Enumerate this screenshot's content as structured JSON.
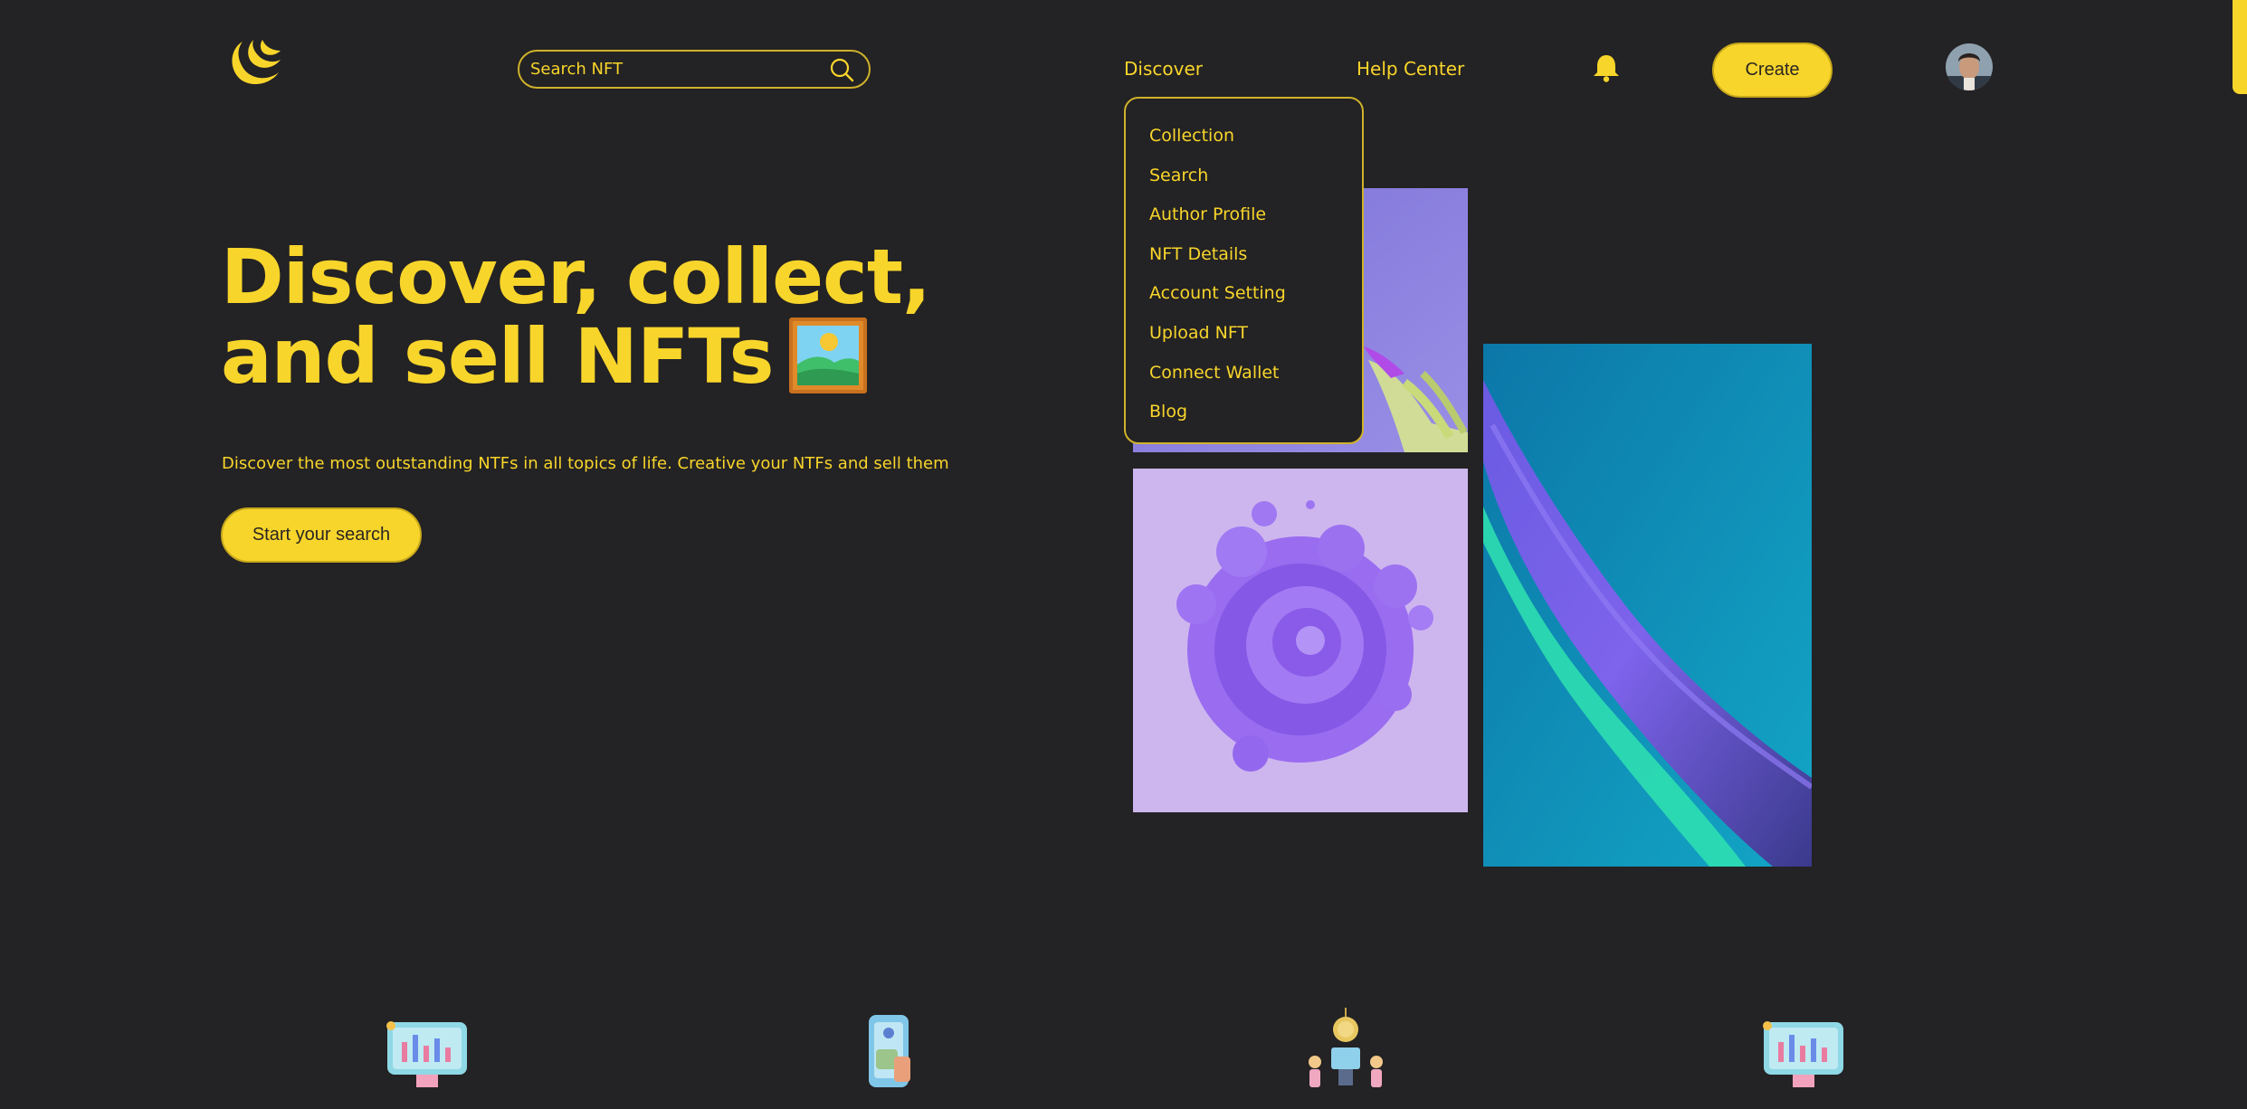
{
  "header": {
    "search": {
      "placeholder": "Search NFT"
    },
    "nav": {
      "discover": "Discover",
      "help_center": "Help Center"
    },
    "create_label": "Create"
  },
  "dropdown": {
    "items": [
      "Collection",
      "Search",
      "Author Profile",
      "NFT Details",
      "Account Setting",
      "Upload NFT",
      "Connect Wallet",
      "Blog"
    ]
  },
  "hero": {
    "title_line1": "Discover, collect,",
    "title_line2": "and sell NFTs",
    "subtitle": "Discover the most outstanding NTFs in all topics of life. Creative your NTFs and sell them",
    "cta_label": "Start your search"
  },
  "icons": {
    "logo": "crescent-logo-icon",
    "search": "search-icon",
    "notifications": "bell-icon",
    "hero_emoji": "framed-picture-icon",
    "bottom": [
      "chart-monitor-icon",
      "wallet-phone-icon",
      "network-coin-icon",
      "chart-monitor-icon"
    ]
  },
  "colors": {
    "background": "#232224",
    "accent": "#F8D52B",
    "accent_border": "#CFB22B",
    "button_text": "#2A2622"
  }
}
